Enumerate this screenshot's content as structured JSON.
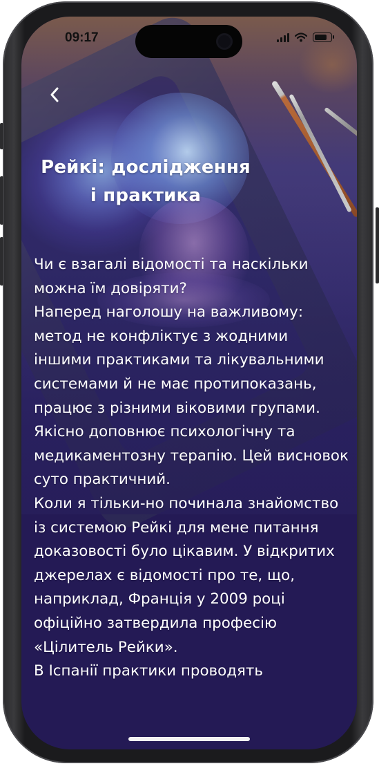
{
  "status_bar": {
    "time": "09:17",
    "battery_level": 0.85
  },
  "nav": {
    "back_icon": "chevron-left-icon"
  },
  "article": {
    "title_lines": [
      "Рейкі: дослідження",
      "і практика"
    ],
    "paragraphs": [
      "Чи є взагалі відомості та наскільки можна їм довіряти?",
      "Наперед наголошу на важливому: метод не конфліктує з жодними іншими практиками та лікувальними системами й не має протипоказань, працює з різними віковими групами. Якісно доповнює психологічну та медикаментозну терапію. Цей висновок суто практичний.",
      "Коли я тільки-но починала знайомство із системою Рейкі для мене питання доказовості було цікавим. У відкритих джерелах є відомості про те, що, наприклад, Франція у 2009 році офіційно затвердила професію «Цілитель Рейки».",
      "В Іспанії практики проводять"
    ]
  },
  "colors": {
    "screen_background": "#241a55",
    "text": "#ffffff",
    "device_frame": "#1b1b1d"
  }
}
